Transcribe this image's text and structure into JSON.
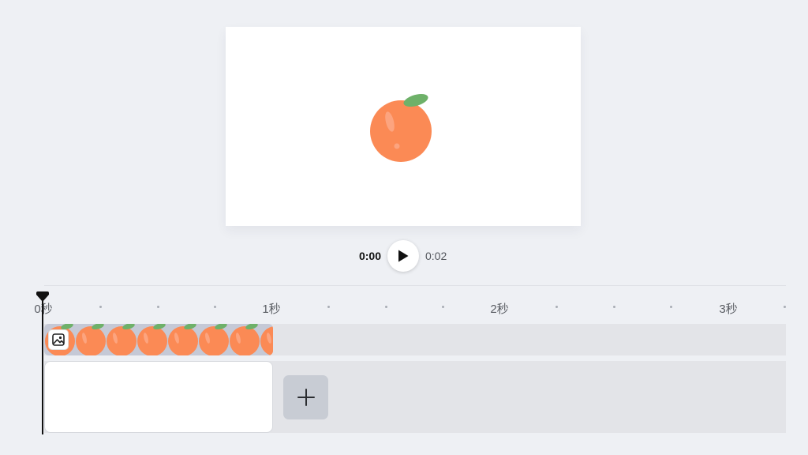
{
  "preview": {
    "background": "#ffffff",
    "image_icon": "orange-fruit-illustration"
  },
  "playback": {
    "current_time": "0:00",
    "total_time": "0:02",
    "play_icon": "play-icon"
  },
  "timeline": {
    "ruler": {
      "labels": [
        "0秒",
        "1秒",
        "2秒",
        "3秒"
      ]
    },
    "image_track": {
      "clip_icon": "image-icon",
      "thumbnail": "orange-fruit-illustration"
    },
    "add_button_icon": "plus-icon"
  },
  "colors": {
    "page_background": "#eef0f4",
    "track_background": "#e3e4e8",
    "orange": "#fb8a55",
    "leaf": "#6eb169",
    "add_button": "#c8ccd4"
  }
}
